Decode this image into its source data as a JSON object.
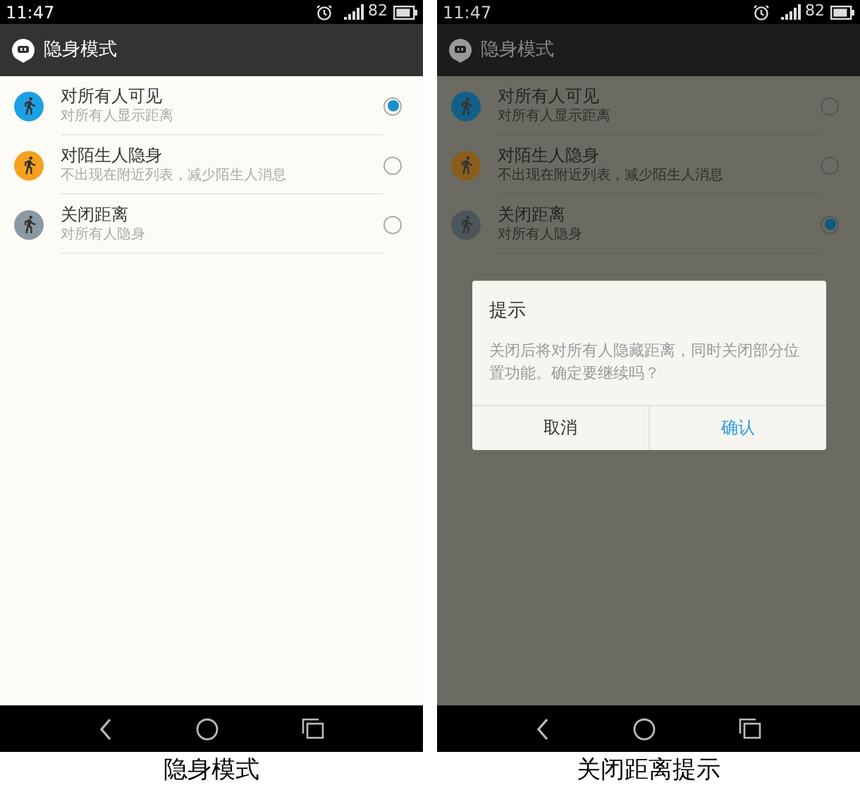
{
  "screens": [
    {
      "status_bar": {
        "time": "11:47",
        "battery": "82"
      },
      "title": "隐身模式",
      "dimmed": false,
      "options": [
        {
          "title": "对所有人可见",
          "subtitle": "对所有人显示距离",
          "kind": "visible",
          "selected": true
        },
        {
          "title": "对陌生人隐身",
          "subtitle": "不出现在附近列表，减少陌生人消息",
          "kind": "stranger",
          "selected": false
        },
        {
          "title": "关闭距离",
          "subtitle": "对所有人隐身",
          "kind": "hidden",
          "selected": false
        }
      ],
      "caption": "隐身模式"
    },
    {
      "status_bar": {
        "time": "11:47",
        "battery": "82"
      },
      "title": "隐身模式",
      "dimmed": true,
      "options": [
        {
          "title": "对所有人可见",
          "subtitle": "对所有人显示距离",
          "kind": "visible",
          "selected": false
        },
        {
          "title": "对陌生人隐身",
          "subtitle": "不出现在附近列表，减少陌生人消息",
          "kind": "stranger",
          "selected": false
        },
        {
          "title": "关闭距离",
          "subtitle": "对所有人隐身",
          "kind": "hidden",
          "selected": true
        }
      ],
      "dialog": {
        "title": "提示",
        "message": "关闭后将对所有人隐藏距离，同时关闭部分位置功能。确定要继续吗？",
        "buttons": [
          {
            "label": "取消",
            "kind": "cancel"
          },
          {
            "label": "确认",
            "kind": "confirm"
          }
        ]
      },
      "caption": "关闭距离提示"
    }
  ]
}
